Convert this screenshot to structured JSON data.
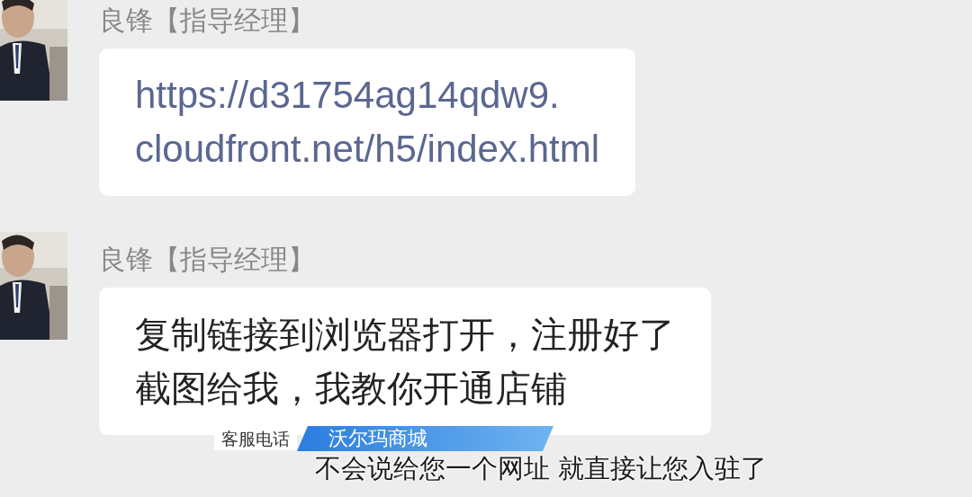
{
  "messages": [
    {
      "sender": "良锋【指导经理】",
      "kind": "link",
      "lines": [
        "https://d31754ag14qdw9.",
        "cloudfront.net/h5/index.html"
      ]
    },
    {
      "sender": "良锋【指导经理】",
      "kind": "text",
      "lines": [
        "复制链接到浏览器打开，注册好了",
        "截图给我，我教你开通店铺"
      ]
    }
  ],
  "lower_third": {
    "label": "客服电话",
    "title": "沃尔玛商城"
  },
  "subtitle": "不会说给您一个网址 就直接让您入驻了"
}
